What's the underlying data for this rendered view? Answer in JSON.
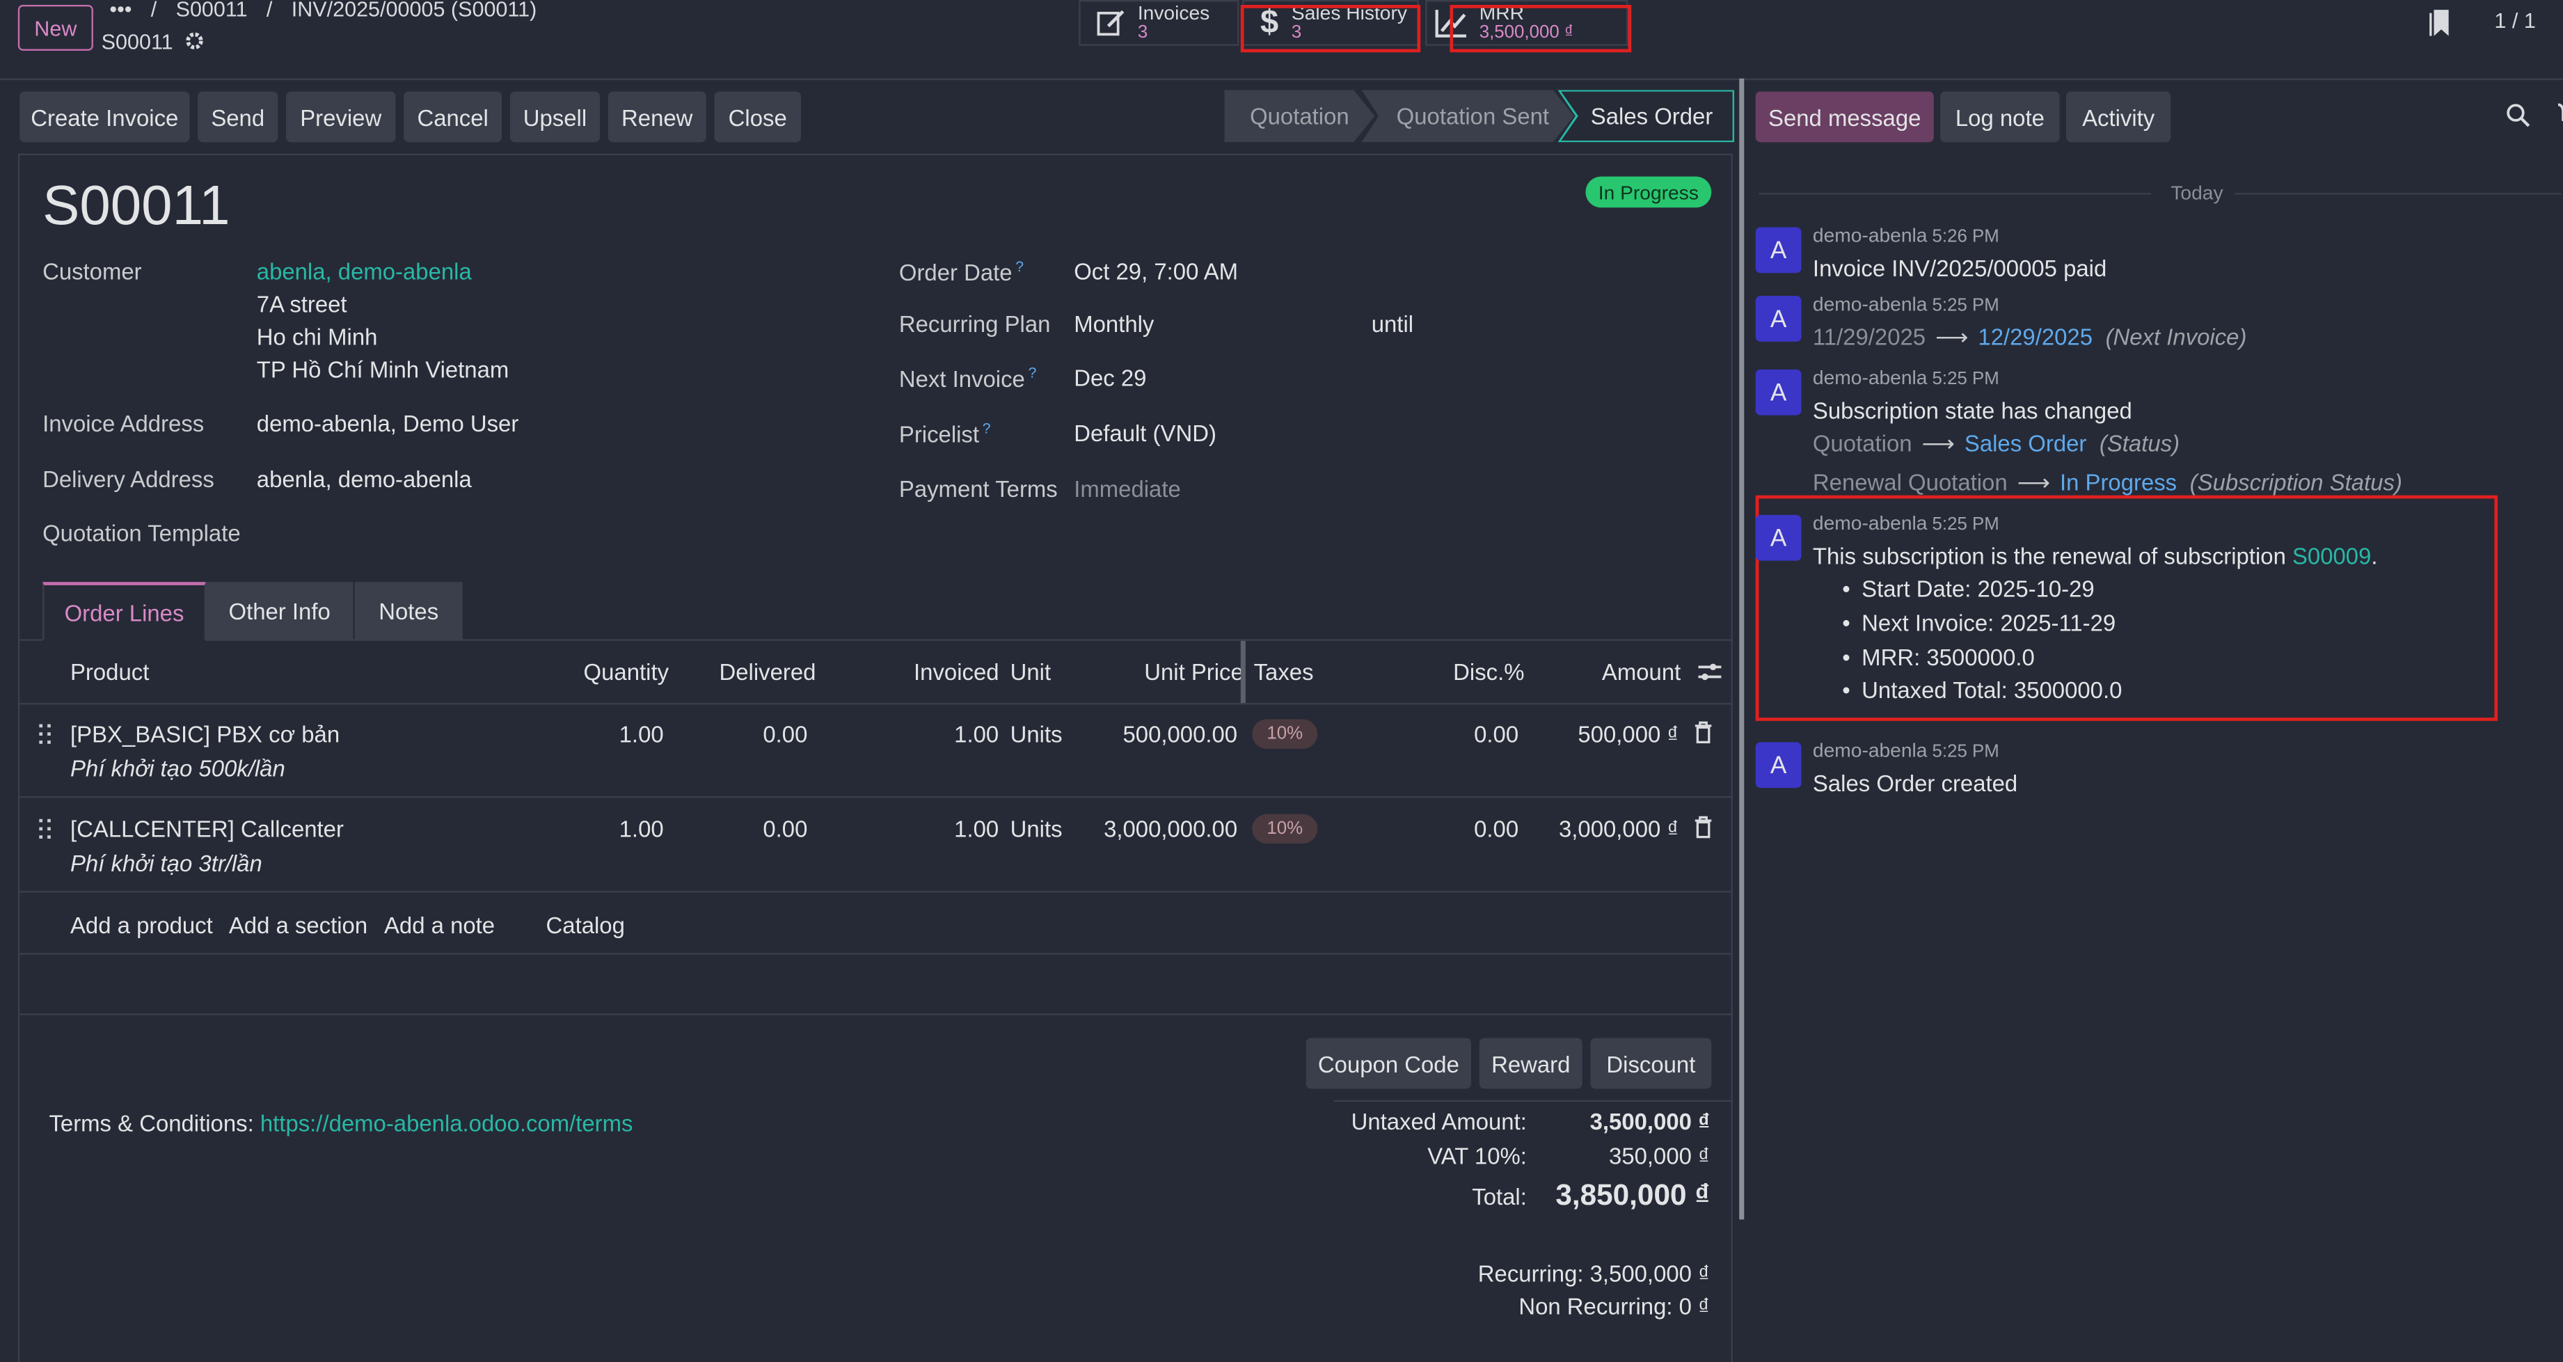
{
  "topbar": {
    "new_label": "New",
    "breadcrumb": [
      "•••",
      "/",
      "S00011",
      "/",
      "INV/2025/00005 (S00011)"
    ],
    "record_name": "S00011",
    "pager": "1 / 1"
  },
  "smart_buttons": [
    {
      "label": "Invoices",
      "value": "3"
    },
    {
      "label": "Sales History",
      "value": "3"
    },
    {
      "label": "MRR",
      "value": "3,500,000 ₫"
    }
  ],
  "actions": [
    "Create Invoice",
    "Send",
    "Preview",
    "Cancel",
    "Upsell",
    "Renew",
    "Close"
  ],
  "stages": [
    "Quotation",
    "Quotation Sent",
    "Sales Order"
  ],
  "form": {
    "name": "S00011",
    "status_badge": "In Progress",
    "customer_label": "Customer",
    "customer_name": "abenla, demo-abenla",
    "customer_addr1": "7A street",
    "customer_addr2": "Ho chi Minh",
    "customer_addr3": "TP Hồ Chí Minh Vietnam",
    "invoice_address_label": "Invoice Address",
    "invoice_address": "demo-abenla, Demo User",
    "delivery_address_label": "Delivery Address",
    "delivery_address": "abenla, demo-abenla",
    "quotation_template_label": "Quotation Template",
    "order_date_label": "Order Date",
    "order_date": "Oct 29, 7:00 AM",
    "recurring_plan_label": "Recurring Plan",
    "recurring_plan": "Monthly",
    "until_label": "until",
    "next_invoice_label": "Next Invoice",
    "next_invoice": "Dec 29",
    "pricelist_label": "Pricelist",
    "pricelist": "Default (VND)",
    "payment_terms_label": "Payment Terms",
    "payment_terms": "Immediate",
    "help_mark": "?"
  },
  "tabs": [
    "Order Lines",
    "Other Info",
    "Notes"
  ],
  "table": {
    "headers": [
      "Product",
      "Quantity",
      "Delivered",
      "Invoiced",
      "Unit",
      "Unit Price",
      "Taxes",
      "Disc.%",
      "Amount"
    ],
    "rows": [
      {
        "product": "[PBX_BASIC] PBX cơ bản",
        "desc": "Phí khởi tạo 500k/lần",
        "qty": "1.00",
        "delivered": "0.00",
        "invoiced": "1.00",
        "unit": "Units",
        "price": "500,000.00",
        "tax": "10%",
        "disc": "0.00",
        "amount": "500,000 ₫"
      },
      {
        "product": "[CALLCENTER] Callcenter",
        "desc": "Phí khởi tạo 3tr/lần",
        "qty": "1.00",
        "delivered": "0.00",
        "invoiced": "1.00",
        "unit": "Units",
        "price": "3,000,000.00",
        "tax": "10%",
        "disc": "0.00",
        "amount": "3,000,000 ₫"
      }
    ],
    "add_links": [
      "Add a product",
      "Add a section",
      "Add a note",
      "Catalog"
    ]
  },
  "bottom_buttons": [
    "Coupon Code",
    "Reward",
    "Discount"
  ],
  "terms": {
    "label": "Terms & Conditions:",
    "url": "https://demo-abenla.odoo.com/terms"
  },
  "totals": {
    "untaxed_label": "Untaxed Amount:",
    "untaxed": "3,500,000 ₫",
    "vat_label": "VAT 10%:",
    "vat": "350,000 ₫",
    "total_label": "Total:",
    "total": "3,850,000 ₫",
    "recurring": "Recurring: 3,500,000 ₫",
    "non_recurring": "Non Recurring: 0 ₫"
  },
  "chatter": {
    "buttons": [
      "Send message",
      "Log note",
      "Activity"
    ],
    "today": "Today",
    "messages": [
      {
        "author": "demo-abenla",
        "time": "5:26 PM",
        "text": "Invoice INV/2025/00005 paid"
      },
      {
        "author": "demo-abenla",
        "time": "5:25 PM",
        "old": "11/29/2025",
        "new": "12/29/2025",
        "field": "(Next Invoice)"
      },
      {
        "author": "demo-abenla",
        "time": "5:25 PM",
        "text": "Subscription state has changed",
        "old": "Quotation",
        "new": "Sales Order",
        "field": "(Status)",
        "old2": "Renewal Quotation",
        "new2": "In Progress",
        "field2": "(Subscription Status)"
      },
      {
        "author": "demo-abenla",
        "time": "5:25 PM",
        "text": "This subscription is the renewal of subscription",
        "ref": "S00009",
        "ref_end": ".",
        "bullets": [
          "Start Date: 2025-10-29",
          "Next Invoice: 2025-11-29",
          "MRR: 3500000.0",
          "Untaxed Total: 3500000.0"
        ]
      },
      {
        "author": "demo-abenla",
        "time": "5:25 PM",
        "text": "Sales Order created"
      }
    ],
    "avatar_letter": "A"
  },
  "colors": {
    "accent": "#d98ac8",
    "link": "#28b8a6",
    "badge_green": "#28c76f",
    "highlight": "#e02020"
  }
}
